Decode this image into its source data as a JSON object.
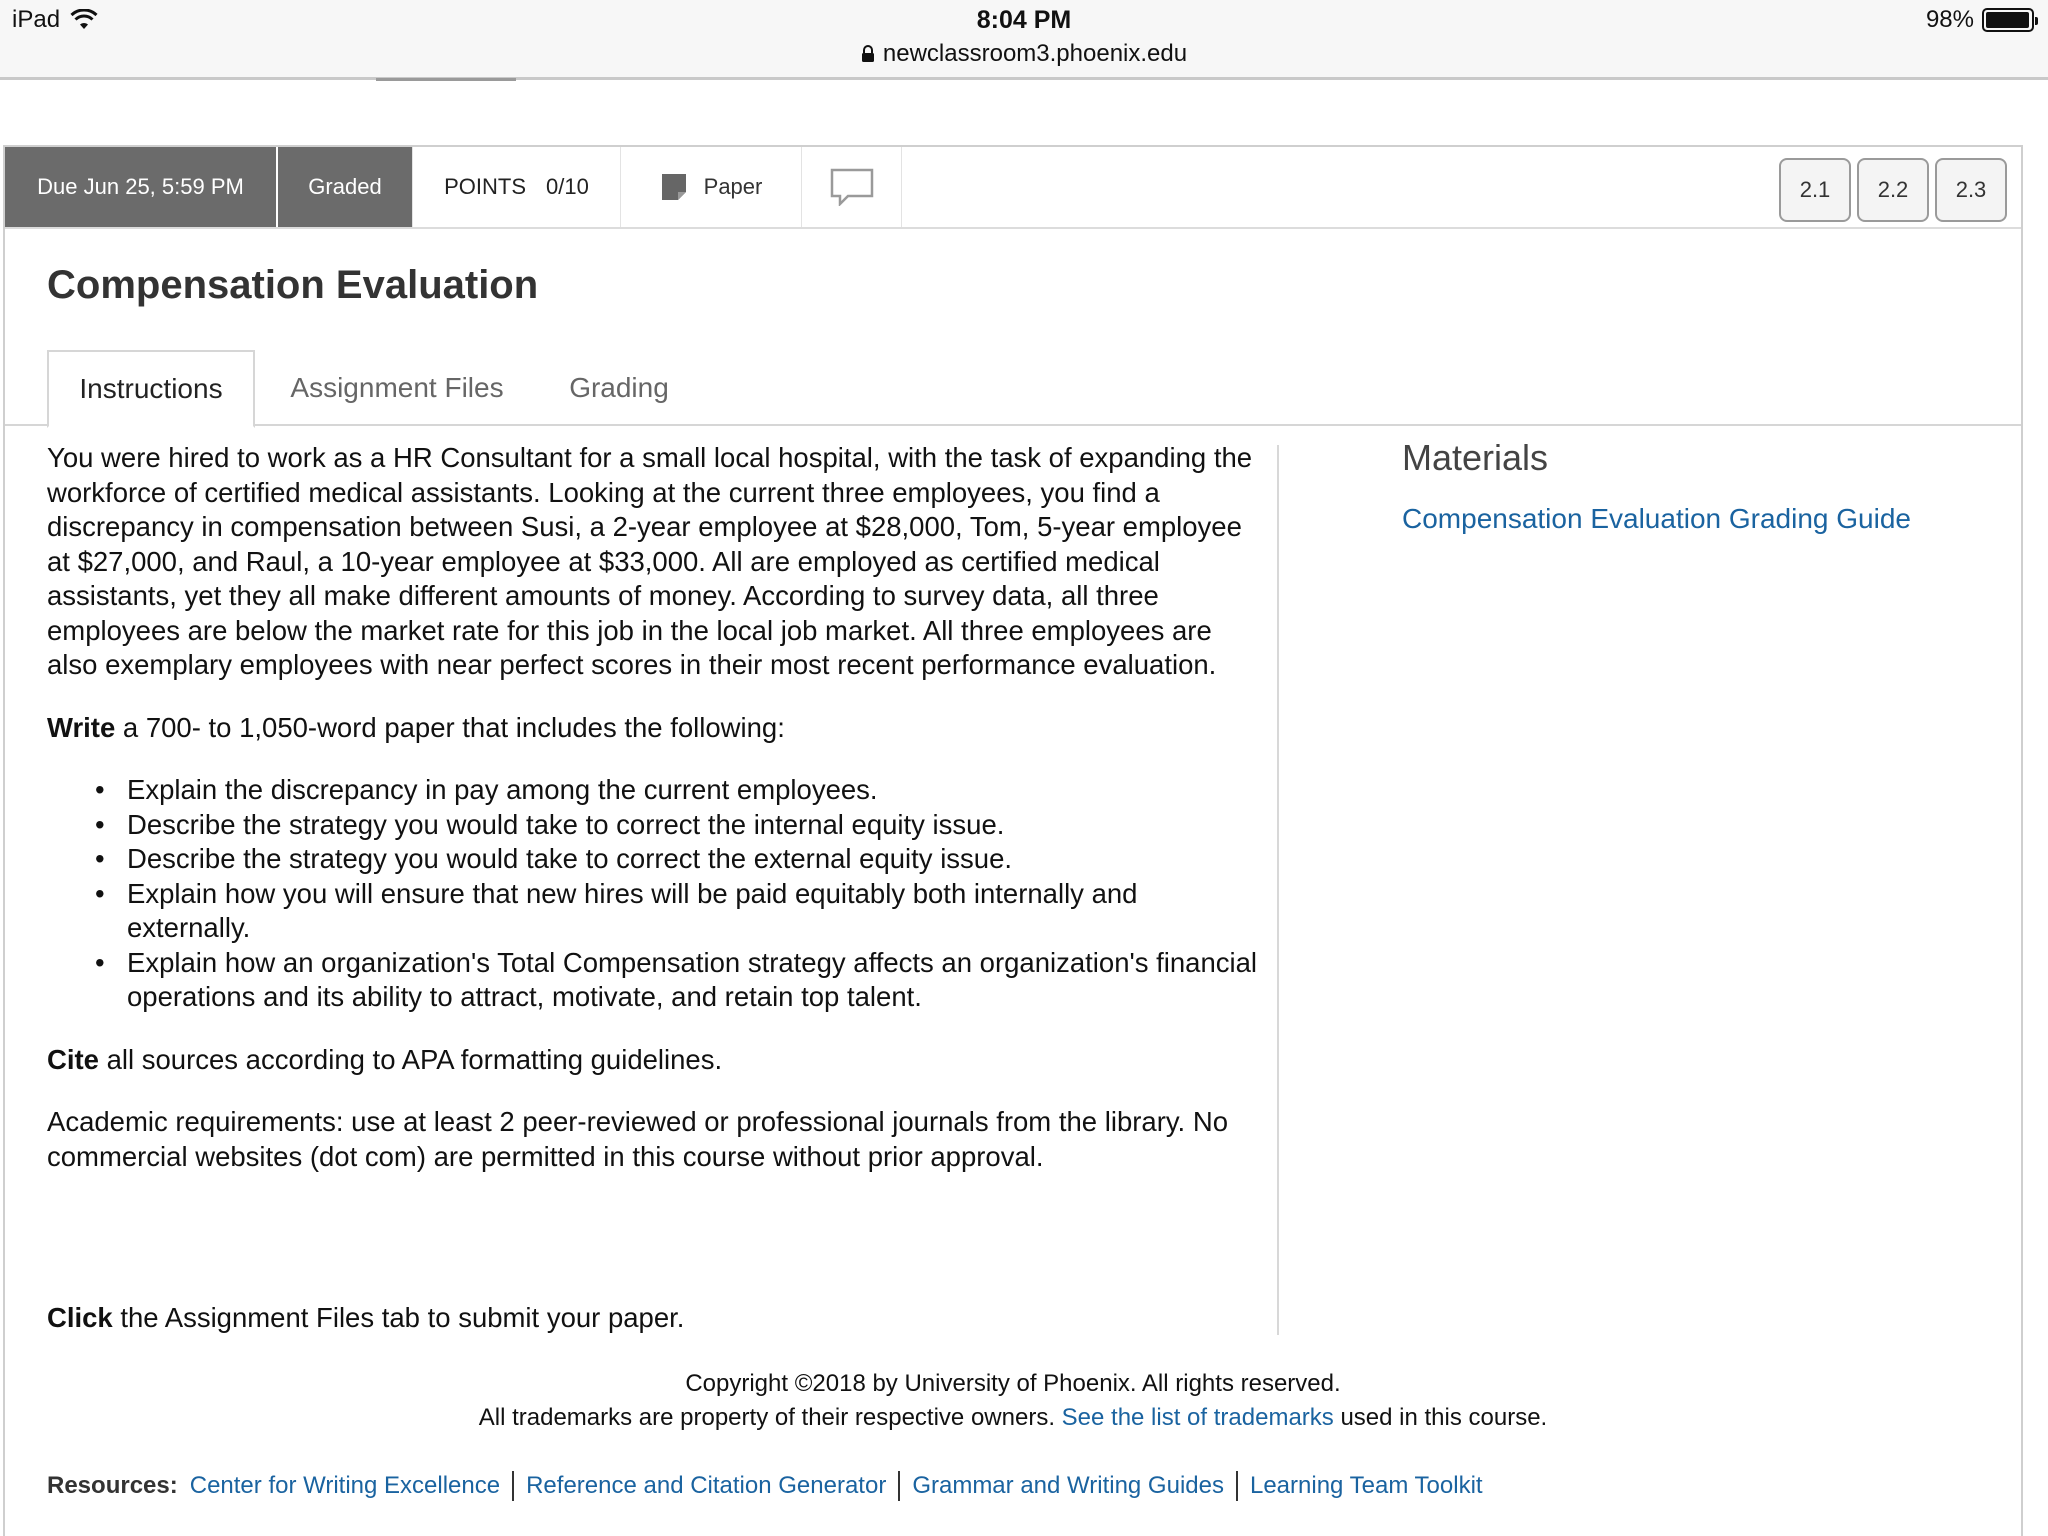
{
  "status_bar": {
    "device": "iPad",
    "time": "8:04 PM",
    "url": "newclassroom3.phoenix.edu",
    "battery": "98%",
    "battery_level": 0.98
  },
  "toolbar": {
    "due": "Due Jun 25, 5:59 PM",
    "graded": "Graded",
    "points_label": "POINTS",
    "points_value": "0/10",
    "paper_label": "Paper",
    "pager": [
      "2.1",
      "2.2",
      "2.3"
    ]
  },
  "page_title": "Compensation Evaluation",
  "tabs": [
    {
      "label": "Instructions",
      "active": true
    },
    {
      "label": "Assignment Files",
      "active": false
    },
    {
      "label": "Grading",
      "active": false
    }
  ],
  "instructions": {
    "intro": "You were hired to work as a HR Consultant for a small local hospital, with the task of expanding the workforce of certified medical assistants.  Looking at the current three employees, you find a discrepancy in compensation between Susi, a 2-year employee at $28,000, Tom, 5-year employee at $27,000, and Raul, a 10-year employee at $33,000. All are employed as certified medical assistants, yet they all make different amounts of money.  According to survey data, all three employees are below the market rate for this job in the local job market.  All three employees are also exemplary employees with near perfect scores in their most recent performance evaluation.",
    "write_bold": "Write",
    "write_rest": " a 700- to 1,050-word paper that includes the following:",
    "bullets": [
      "Explain the discrepancy in pay among the current employees.",
      "Describe the strategy you would take to correct the internal equity issue.",
      "Describe the strategy you would take to correct the external equity issue.",
      "Explain how you will ensure that new hires will be paid equitably both internally and externally.",
      "Explain how an organization's Total Compensation strategy affects an organization's financial operations and its ability to attract, motivate, and retain top talent."
    ],
    "cite_bold": "Cite",
    "cite_rest": " all sources according to APA formatting guidelines.",
    "academic": "Academic requirements:  use at least 2 peer-reviewed or professional journals from the library. No commercial websites (dot com) are permitted in this course without prior approval.",
    "click_bold": "Click",
    "click_rest": " the Assignment Files tab to submit your paper."
  },
  "materials": {
    "title": "Materials",
    "link": "Compensation Evaluation Grading Guide"
  },
  "footer": {
    "copyright": "Copyright ©2018 by University of Phoenix. All rights reserved.",
    "trademarks_pre": "All trademarks are property of their respective owners. ",
    "trademarks_link": "See the list of trademarks",
    "trademarks_post": " used in this course.",
    "resources_label": "Resources:",
    "resources": [
      "Center for Writing Excellence",
      "Reference and Citation Generator",
      "Grammar and Writing Guides",
      "Learning Team Toolkit"
    ]
  },
  "colors": {
    "accent_link": "#1a63a0",
    "toolbar_dark": "#6b6b6b"
  }
}
